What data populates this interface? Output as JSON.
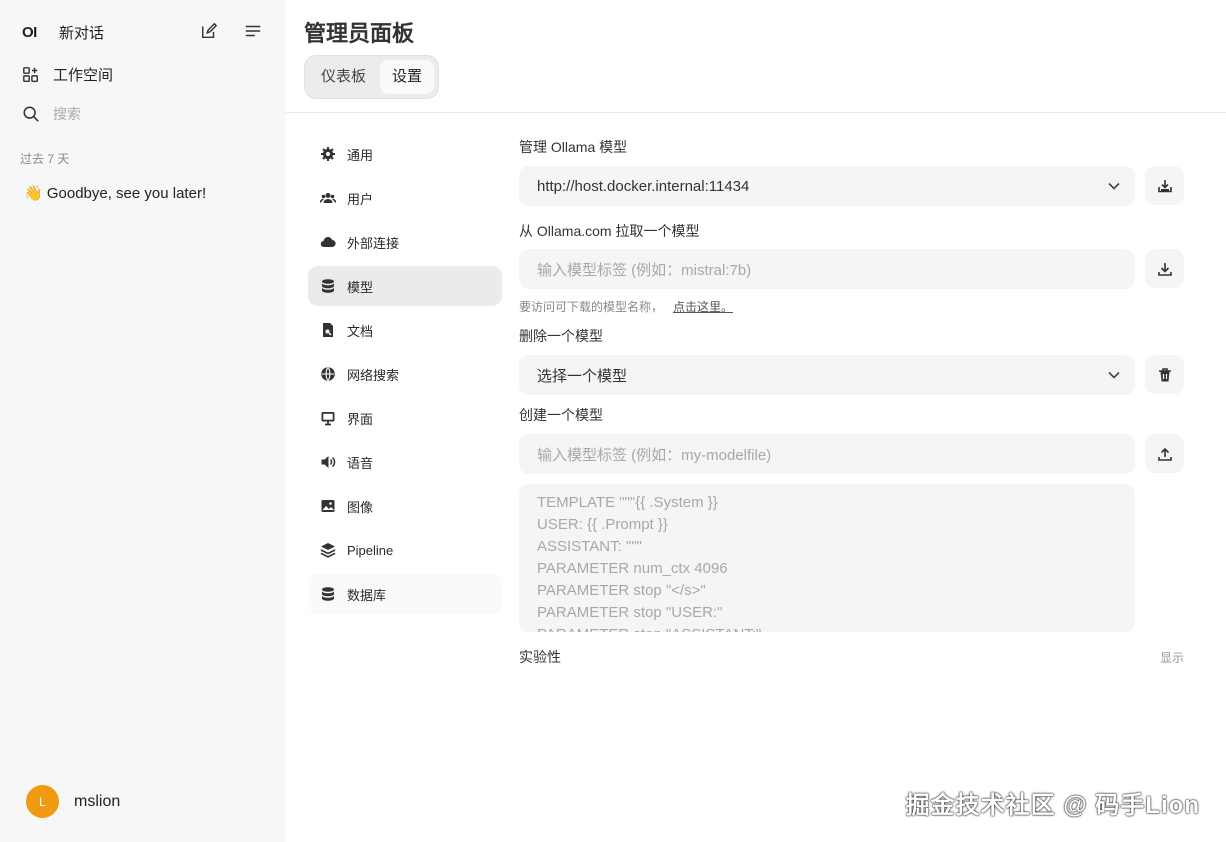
{
  "sidebar": {
    "logo": "OI",
    "new_chat": "新对话",
    "workspace": "工作空间",
    "search_placeholder": "搜索",
    "section_label": "过去 7 天",
    "chat_item": "👋 Goodbye, see you later!",
    "user": {
      "initial": "L",
      "name": "mslion"
    }
  },
  "header": {
    "title": "管理员面板",
    "tabs": [
      {
        "label": "仪表板"
      },
      {
        "label": "设置"
      }
    ]
  },
  "settings_nav": [
    {
      "label": "通用",
      "icon": "gear-icon"
    },
    {
      "label": "用户",
      "icon": "users-icon"
    },
    {
      "label": "外部连接",
      "icon": "cloud-icon"
    },
    {
      "label": "模型",
      "icon": "database-icon"
    },
    {
      "label": "文档",
      "icon": "document-icon"
    },
    {
      "label": "网络搜索",
      "icon": "globe-icon"
    },
    {
      "label": "界面",
      "icon": "monitor-icon"
    },
    {
      "label": "语音",
      "icon": "speaker-icon"
    },
    {
      "label": "图像",
      "icon": "image-icon"
    },
    {
      "label": "Pipeline",
      "icon": "layers-icon"
    },
    {
      "label": "数据库",
      "icon": "database-icon"
    }
  ],
  "models": {
    "manage_label": "管理 Ollama 模型",
    "ollama_url": "http://host.docker.internal:11434",
    "pull_label": "从 Ollama.com 拉取一个模型",
    "pull_placeholder": "输入模型标签 (例如：mistral:7b)",
    "hint_text": "要访问可下载的模型名称，",
    "hint_link": "点击这里。",
    "delete_label": "删除一个模型",
    "delete_select": "选择一个模型",
    "create_label": "创建一个模型",
    "create_placeholder": "输入模型标签 (例如：my-modelfile)",
    "modelfile_lines": [
      "TEMPLATE \"\"\"{{ .System }}",
      "USER: {{ .Prompt }}",
      "ASSISTANT: \"\"\"",
      "PARAMETER num_ctx 4096",
      "PARAMETER stop \"</s>\"",
      "PARAMETER stop \"USER:\"",
      "PARAMETER stop \"ASSISTANT:\""
    ],
    "experimental_label": "实验性",
    "experimental_toggle": "显示"
  },
  "watermark": "掘金技术社区 @ 码手Lion",
  "colors": {
    "avatar": "#f09a12",
    "active_nav": "#ebebeb"
  }
}
